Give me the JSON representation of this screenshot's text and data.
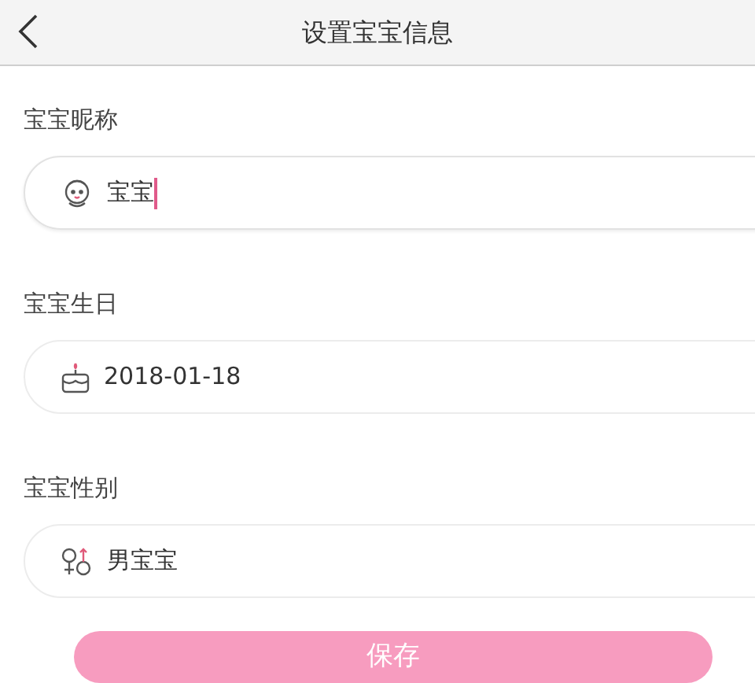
{
  "header": {
    "title": "设置宝宝信息"
  },
  "fields": [
    {
      "label": "宝宝昵称",
      "kind": "nickname",
      "value": "宝宝",
      "focused": true
    },
    {
      "label": "宝宝生日",
      "kind": "birthday",
      "value": "2018-01-18",
      "focused": false
    },
    {
      "label": "宝宝性别",
      "kind": "gender",
      "value": "男宝宝",
      "focused": false
    }
  ],
  "save_button": {
    "label": "保存"
  }
}
